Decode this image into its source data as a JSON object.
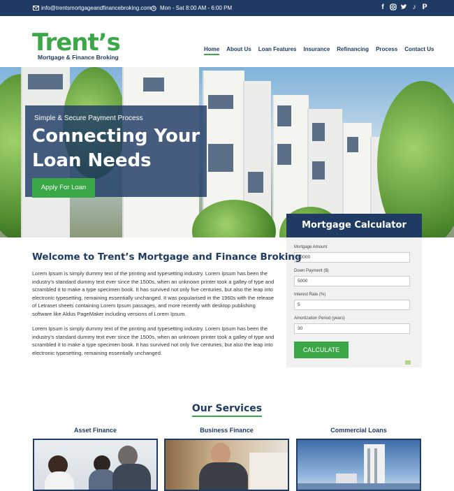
{
  "topbar": {
    "email": "info@trentsmortgageandfinancebroking.com",
    "hours": "Mon - Sat 8:00 AM - 6:00 PM",
    "social": [
      "facebook-icon",
      "instagram-icon",
      "twitter-icon",
      "tiktok-icon",
      "pinterest-icon"
    ]
  },
  "logo": {
    "brand": "Trent’s",
    "sub": "Mortgage & Finance Broking"
  },
  "nav": {
    "items": [
      "Home",
      "About Us",
      "Loan Features",
      "Insurance",
      "Refinancing",
      "Process",
      "Contact Us"
    ],
    "active": "Home"
  },
  "hero": {
    "kicker": "Simple & Secure Payment Process",
    "title": "Connecting Your Loan Needs",
    "cta": "Apply For Loan"
  },
  "calculator": {
    "title": "Mortgage Calculator",
    "fields": [
      {
        "label": "Mortgage Amount",
        "value": "40000"
      },
      {
        "label": "Down Payment ($)",
        "value": "5000"
      },
      {
        "label": "Interest Rate (%)",
        "value": "5"
      },
      {
        "label": "Amortization Period (years)",
        "value": "30"
      }
    ],
    "button": "CALCULATE"
  },
  "welcome": {
    "title": "Welcome to Trent’s Mortgage and Finance Broking",
    "p1": "Lorem Ipsum is simply dummy text of the printing and typesetting industry. Lorem Ipsum has been the industry’s standard dummy text ever since the 1500s, when an unknown printer took a galley of type and scrambled it to make a type specimen book. It has survived not only five centuries, but also the leap into electronic typesetting, remaining essentially unchanged. It was popularised in the 1960s with the release of Letraset sheets containing Lorem Ipsum passages, and more recently with desktop publishing software like Aldus PageMaker including versions of Lorem Ipsum.",
    "p2": "Lorem Ipsum is simply dummy text of the printing and typesetting industry. Lorem Ipsum has been the industry’s standard dummy text ever since the 1500s, when an unknown printer took a galley of type and scrambled it to make a type specimen book. It has survived not only five centuries, but also the leap into electronic typesetting, remaining essentially unchanged."
  },
  "services": {
    "title": "Our Services",
    "items": [
      "Asset Finance",
      "Business Finance",
      "Commercial Loans"
    ]
  },
  "colors": {
    "navy": "#1f3b63",
    "green": "#3aa847"
  }
}
